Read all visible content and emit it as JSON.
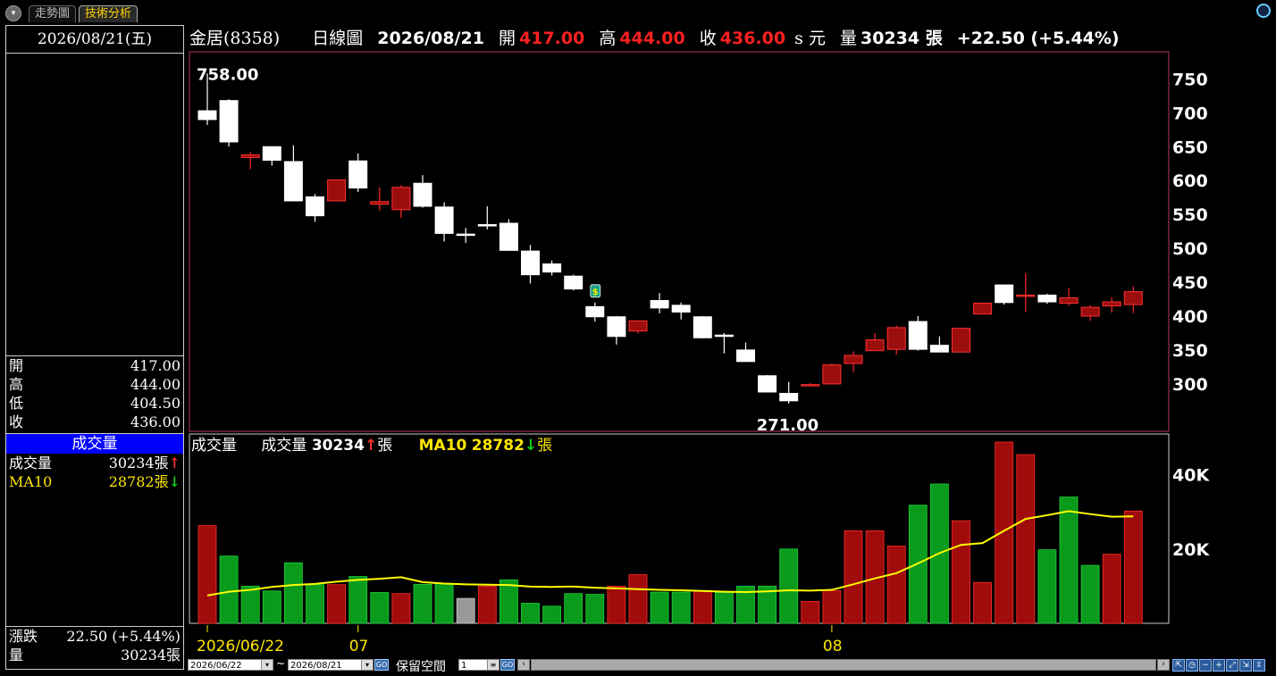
{
  "tabs": [
    {
      "label": "走勢圖",
      "active": false
    },
    {
      "label": "技術分析",
      "active": true
    }
  ],
  "left_panel": {
    "date": "2026/08/21(五)",
    "ohlc": [
      {
        "label": "開",
        "value": "417.00"
      },
      {
        "label": "高",
        "value": "444.00"
      },
      {
        "label": "低",
        "value": "404.50"
      },
      {
        "label": "收",
        "value": "436.00"
      }
    ],
    "volume_title": "成交量",
    "volume_rows": [
      {
        "label": "成交量",
        "value": "30234張",
        "dir": "up"
      },
      {
        "label": "MA10",
        "value": "28782張",
        "dir": "down"
      }
    ],
    "change": {
      "label": "漲跌",
      "value": "22.50 (+5.44%)"
    },
    "qty": {
      "label": "量",
      "value": "30234張"
    }
  },
  "header": {
    "stock": "金居(8358)",
    "period": "日線圖",
    "date": "2026/08/21",
    "open_label": "開",
    "open": "417.00",
    "high_label": "高",
    "high": "444.00",
    "close_label": "收",
    "close": "436.00",
    "unit_label": "s 元",
    "vol_label": "量",
    "vol": "30234 張",
    "change": "+22.50 (+5.44%)"
  },
  "vol_header": {
    "title": "成交量",
    "vol_label": "成交量",
    "vol_value": "30234",
    "unit": "張",
    "ma_label": "MA10",
    "ma_value": "28782"
  },
  "bottom_bar": {
    "start_date": "2026/06/22",
    "tilde": "~",
    "end_date": "2026/08/21",
    "go": "GO",
    "reserve_label": "保留空間",
    "reserve_value": "1"
  },
  "colors": {
    "up": "#9b0e0e",
    "down": "#ffffff",
    "vol_up": "#a00c0c",
    "vol_down": "#0a9a1c",
    "ma": "#ffff00",
    "frame": "#b23b5a"
  },
  "chart_data": [
    {
      "type": "candlestick",
      "title": "金居(8358) 日線圖",
      "ylim": [
        230,
        790
      ],
      "yticks": [
        300,
        350,
        400,
        450,
        500,
        550,
        600,
        650,
        700,
        750
      ],
      "annotations": [
        {
          "text": "758.00",
          "kind": "high"
        },
        {
          "text": "271.00",
          "kind": "low"
        }
      ],
      "dividend_marker": "$",
      "candles": [
        {
          "o": 703,
          "h": 758,
          "l": 682,
          "c": 690
        },
        {
          "o": 718,
          "h": 720,
          "l": 650,
          "c": 657
        },
        {
          "o": 634,
          "h": 642,
          "l": 617,
          "c": 638
        },
        {
          "o": 650,
          "h": 651,
          "l": 622,
          "c": 630
        },
        {
          "o": 628,
          "h": 652,
          "l": 570,
          "c": 570
        },
        {
          "o": 576,
          "h": 580,
          "l": 539,
          "c": 548
        },
        {
          "o": 570,
          "h": 601,
          "l": 570,
          "c": 601
        },
        {
          "o": 629,
          "h": 640,
          "l": 583,
          "c": 589
        },
        {
          "o": 565,
          "h": 590,
          "l": 556,
          "c": 569
        },
        {
          "o": 557,
          "h": 593,
          "l": 545,
          "c": 590
        },
        {
          "o": 596,
          "h": 608,
          "l": 560,
          "c": 562
        },
        {
          "o": 561,
          "h": 568,
          "l": 510,
          "c": 522
        },
        {
          "o": 521,
          "h": 530,
          "l": 508,
          "c": 521
        },
        {
          "o": 535,
          "h": 562,
          "l": 528,
          "c": 535
        },
        {
          "o": 537,
          "h": 543,
          "l": 497,
          "c": 497
        },
        {
          "o": 496,
          "h": 505,
          "l": 448,
          "c": 461
        },
        {
          "o": 477,
          "h": 482,
          "l": 460,
          "c": 465
        },
        {
          "o": 459,
          "h": 461,
          "l": 438,
          "c": 440
        },
        {
          "o": 414,
          "h": 420,
          "l": 392,
          "c": 399
        },
        {
          "o": 399,
          "h": 400,
          "l": 358,
          "c": 370
        },
        {
          "o": 378,
          "h": 394,
          "l": 374,
          "c": 393
        },
        {
          "o": 423,
          "h": 434,
          "l": 404,
          "c": 412
        },
        {
          "o": 416,
          "h": 420,
          "l": 395,
          "c": 406
        },
        {
          "o": 399,
          "h": 400,
          "l": 367,
          "c": 368
        },
        {
          "o": 372,
          "h": 375,
          "l": 345,
          "c": 370
        },
        {
          "o": 350,
          "h": 361,
          "l": 333,
          "c": 333
        },
        {
          "o": 312,
          "h": 313,
          "l": 288,
          "c": 288
        },
        {
          "o": 286,
          "h": 303,
          "l": 271,
          "c": 275
        },
        {
          "o": 297,
          "h": 301,
          "l": 296,
          "c": 299
        },
        {
          "o": 300,
          "h": 330,
          "l": 300,
          "c": 328
        },
        {
          "o": 330,
          "h": 348,
          "l": 317,
          "c": 342
        },
        {
          "o": 349,
          "h": 375,
          "l": 349,
          "c": 365
        },
        {
          "o": 351,
          "h": 386,
          "l": 343,
          "c": 383
        },
        {
          "o": 392,
          "h": 400,
          "l": 349,
          "c": 351
        },
        {
          "o": 357,
          "h": 370,
          "l": 348,
          "c": 347
        },
        {
          "o": 347,
          "h": 383,
          "l": 347,
          "c": 382
        },
        {
          "o": 403,
          "h": 420,
          "l": 403,
          "c": 419
        },
        {
          "o": 446,
          "h": 446,
          "l": 417,
          "c": 420
        },
        {
          "o": 430,
          "h": 463,
          "l": 406,
          "c": 431
        },
        {
          "o": 431,
          "h": 433,
          "l": 418,
          "c": 421
        },
        {
          "o": 419,
          "h": 441,
          "l": 415,
          "c": 427
        },
        {
          "o": 400,
          "h": 416,
          "l": 393,
          "c": 413
        },
        {
          "o": 415,
          "h": 428,
          "l": 405,
          "c": 421
        },
        {
          "o": 417,
          "h": 444,
          "l": 404.5,
          "c": 436
        }
      ]
    },
    {
      "type": "bar",
      "title": "成交量",
      "ylim": [
        0,
        50000
      ],
      "yticks": [
        {
          "value": 20000,
          "label": "20K"
        },
        {
          "value": 40000,
          "label": "40K"
        }
      ],
      "x_labels": [
        {
          "index": 0,
          "label": "2026/06/22"
        },
        {
          "index": 7,
          "label": "07"
        },
        {
          "index": 29,
          "label": "08"
        }
      ],
      "volume": [
        26300,
        18100,
        10000,
        8700,
        16300,
        10400,
        10400,
        12600,
        8300,
        8000,
        10500,
        10700,
        6700,
        10000,
        11700,
        5400,
        4600,
        8000,
        7800,
        10000,
        13100,
        8400,
        8400,
        8700,
        8300,
        10000,
        10000,
        20000,
        5900,
        8800,
        24900,
        24900,
        20800,
        31800,
        37500,
        27600,
        11000,
        48800,
        45400,
        19800,
        34000,
        15600,
        18600,
        30234
      ],
      "vol_dir": [
        "up",
        "down",
        "down",
        "down",
        "down",
        "down",
        "up",
        "down",
        "down",
        "up",
        "down",
        "down",
        "neutral",
        "up",
        "down",
        "down",
        "down",
        "down",
        "down",
        "up",
        "up",
        "down",
        "down",
        "up",
        "down",
        "down",
        "down",
        "down",
        "up",
        "up",
        "up",
        "up",
        "up",
        "down",
        "down",
        "up",
        "up",
        "up",
        "up",
        "down",
        "down",
        "down",
        "up",
        "up"
      ],
      "ma10": [
        7500,
        8500,
        9000,
        9800,
        10300,
        10600,
        11200,
        11700,
        12000,
        12400,
        11100,
        10700,
        10500,
        10400,
        10300,
        9900,
        9800,
        9900,
        9600,
        9400,
        9200,
        9000,
        8900,
        8700,
        8500,
        8400,
        8600,
        8900,
        8800,
        9000,
        10500,
        12100,
        13500,
        16100,
        18900,
        21100,
        21600,
        24900,
        28100,
        29100,
        30200,
        29400,
        28700,
        28782
      ]
    }
  ]
}
